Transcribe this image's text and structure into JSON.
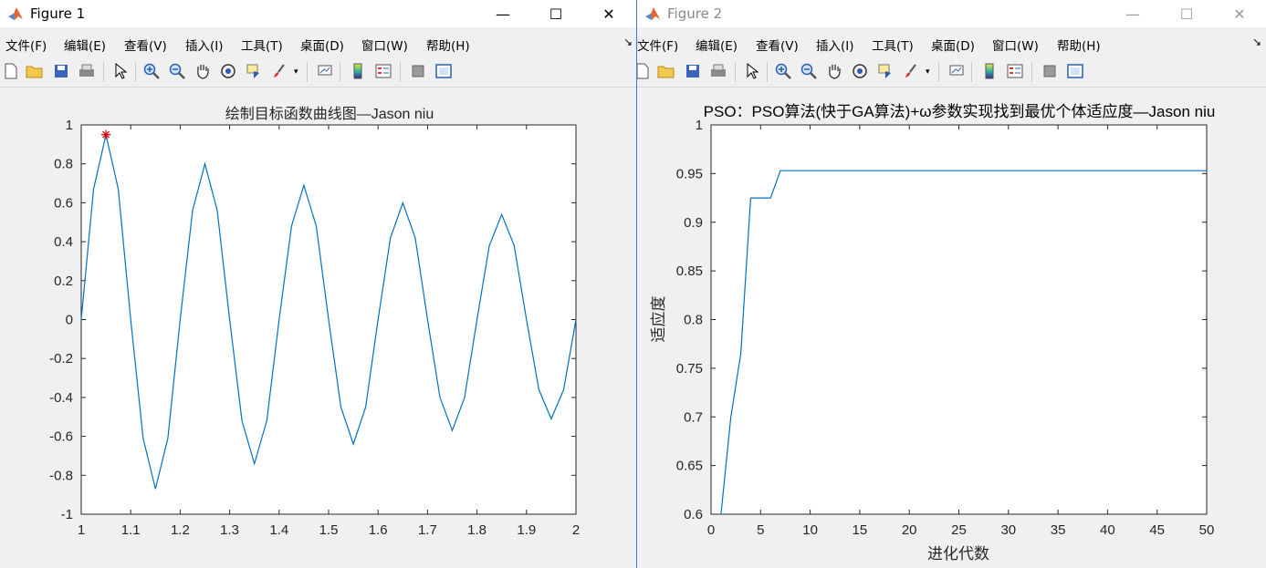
{
  "windows": [
    {
      "title": "Figure 1",
      "active": true,
      "menus": [
        "文件(F)",
        "编辑(E)",
        "查看(V)",
        "插入(I)",
        "工具(T)",
        "桌面(D)",
        "窗口(W)",
        "帮助(H)"
      ],
      "plot": {
        "title": "绘制目标函数曲线图—Jason niu",
        "xticks": [
          "1",
          "1.1",
          "1.2",
          "1.3",
          "1.4",
          "1.5",
          "1.6",
          "1.7",
          "1.8",
          "1.9",
          "2"
        ],
        "yticks": [
          "1",
          "0.8",
          "0.6",
          "0.4",
          "0.2",
          "0",
          "-0.2",
          "-0.4",
          "-0.6",
          "-0.8",
          "-1"
        ]
      }
    },
    {
      "title": "Figure 2",
      "active": false,
      "menus": [
        "文件(F)",
        "编辑(E)",
        "查看(V)",
        "插入(I)",
        "工具(T)",
        "桌面(D)",
        "窗口(W)",
        "帮助(H)"
      ],
      "plot": {
        "title": "PSO：PSO算法(快于GA算法)+ω参数实现找到最优个体适应度—Jason niu",
        "xlabel": "进化代数",
        "ylabel": "适应度",
        "xticks": [
          "0",
          "5",
          "10",
          "15",
          "20",
          "25",
          "30",
          "35",
          "40",
          "45",
          "50"
        ],
        "yticks": [
          "1",
          "0.95",
          "0.9",
          "0.85",
          "0.8",
          "0.75",
          "0.7",
          "0.65",
          "0.6"
        ]
      }
    }
  ],
  "window_controls": {
    "minimize": "—",
    "maximize": "☐",
    "close": "✕"
  },
  "colors": {
    "line": "#0072bd",
    "marker": "#e00000",
    "inactive_text": "#8a8a8a",
    "active_border": "#2b7de1"
  },
  "chart_data": [
    {
      "type": "line",
      "title": "绘制目标函数曲线图—Jason niu",
      "xlabel": "",
      "ylabel": "",
      "xlim": [
        1,
        2
      ],
      "ylim": [
        -1,
        1
      ],
      "grid": false,
      "series": [
        {
          "x": [
            1.0,
            1.025,
            1.05,
            1.075,
            1.1,
            1.125,
            1.15,
            1.175,
            1.2,
            1.225,
            1.25,
            1.275,
            1.3,
            1.325,
            1.35,
            1.375,
            1.4,
            1.425,
            1.45,
            1.475,
            1.5,
            1.525,
            1.55,
            1.575,
            1.6,
            1.625,
            1.65,
            1.675,
            1.7,
            1.725,
            1.75,
            1.775,
            1.8,
            1.825,
            1.85,
            1.875,
            1.9,
            1.925,
            1.95,
            1.975,
            2.0
          ],
          "y": [
            0.0,
            0.67,
            0.95,
            0.67,
            0.0,
            -0.61,
            -0.87,
            -0.61,
            0.0,
            0.56,
            0.8,
            0.56,
            0.0,
            -0.52,
            -0.74,
            -0.52,
            0.0,
            0.48,
            0.69,
            0.48,
            0.0,
            -0.45,
            -0.64,
            -0.45,
            0.0,
            0.42,
            0.6,
            0.42,
            0.0,
            -0.4,
            -0.57,
            -0.4,
            0.0,
            0.38,
            0.54,
            0.38,
            0.0,
            -0.36,
            -0.51,
            -0.36,
            0.0
          ]
        }
      ],
      "marker_point": {
        "x": 1.05,
        "y": 0.95,
        "symbol": "*"
      }
    },
    {
      "type": "line",
      "title": "PSO：PSO算法(快于GA算法)+ω参数实现找到最优个体适应度—Jason niu",
      "xlabel": "进化代数",
      "ylabel": "适应度",
      "xlim": [
        0,
        50
      ],
      "ylim": [
        0.6,
        1
      ],
      "grid": false,
      "series": [
        {
          "x": [
            1,
            2,
            3,
            4,
            5,
            6,
            7,
            8,
            9,
            10,
            11,
            12,
            13,
            14,
            15,
            16,
            17,
            18,
            19,
            20,
            21,
            22,
            23,
            24,
            25,
            26,
            27,
            28,
            29,
            30,
            31,
            32,
            33,
            34,
            35,
            36,
            37,
            38,
            39,
            40,
            41,
            42,
            43,
            44,
            45,
            46,
            47,
            48,
            49,
            50
          ],
          "y": [
            0.6,
            0.7,
            0.765,
            0.925,
            0.925,
            0.925,
            0.953,
            0.953,
            0.953,
            0.953,
            0.953,
            0.953,
            0.953,
            0.953,
            0.953,
            0.953,
            0.953,
            0.953,
            0.953,
            0.953,
            0.953,
            0.953,
            0.953,
            0.953,
            0.953,
            0.953,
            0.953,
            0.953,
            0.953,
            0.953,
            0.953,
            0.953,
            0.953,
            0.953,
            0.953,
            0.953,
            0.953,
            0.953,
            0.953,
            0.953,
            0.953,
            0.953,
            0.953,
            0.953,
            0.953,
            0.953,
            0.953,
            0.953,
            0.953,
            0.953
          ]
        }
      ]
    }
  ]
}
